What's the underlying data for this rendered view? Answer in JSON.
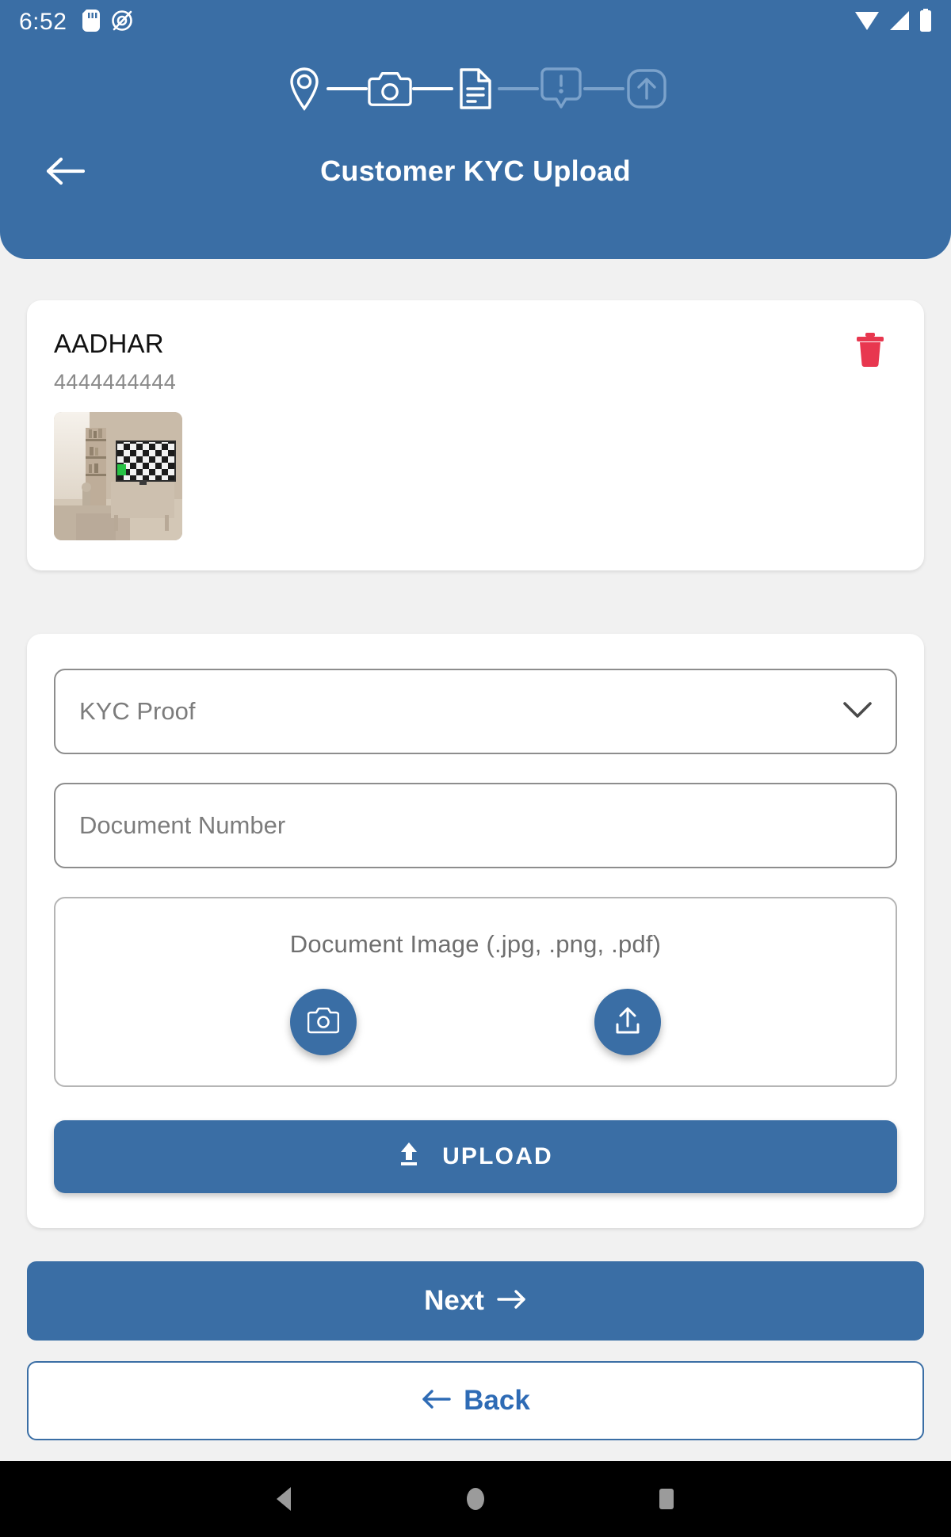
{
  "status_bar": {
    "time": "6:52",
    "left_icons": [
      "sd-card-icon",
      "vibrate-mode-icon"
    ],
    "right_icons": [
      "wifi-icon",
      "cellular-signal-icon",
      "battery-icon"
    ]
  },
  "header": {
    "title": "Customer KYC Upload",
    "back_icon": "arrow-left-icon",
    "background_color": "#3a6ea5",
    "stepper": {
      "steps": [
        {
          "icon": "location-pin-icon",
          "state": "completed"
        },
        {
          "icon": "camera-icon",
          "state": "completed"
        },
        {
          "icon": "document-icon",
          "state": "current"
        },
        {
          "icon": "alert-bubble-icon",
          "state": "pending"
        },
        {
          "icon": "upload-box-icon",
          "state": "pending"
        }
      ],
      "active_color": "#ffffff",
      "inactive_color": "#7ba2cb"
    }
  },
  "uploaded_documents": [
    {
      "title": "AADHAR",
      "number": "4444444444",
      "thumbnail_alt": "room-interior-photo",
      "delete_icon": "trash-icon",
      "delete_color": "#e8374f"
    }
  ],
  "form": {
    "kyc_proof_select": {
      "value": "KYC Proof",
      "chevron_icon": "chevron-down-icon"
    },
    "document_number_input": {
      "value": "",
      "placeholder": "Document Number"
    },
    "document_image": {
      "label": "Document Image (.jpg, .png, .pdf)",
      "camera_button_icon": "camera-icon",
      "upload_button_icon": "upload-icon"
    },
    "upload_button": {
      "label": "UPLOAD",
      "icon": "upload-arrow-icon"
    }
  },
  "navigation": {
    "next": {
      "label": "Next",
      "icon": "arrow-right-icon"
    },
    "back": {
      "label": "Back",
      "icon": "arrow-left-icon"
    }
  },
  "system_nav": {
    "back_icon": "triangle-back-icon",
    "home_icon": "circle-home-icon",
    "recents_icon": "square-recents-icon"
  },
  "theme": {
    "primary": "#3a6ea5",
    "page_background": "#f1f1f1",
    "card_background": "#ffffff",
    "muted_text": "#8a8a8a",
    "danger": "#e8374f",
    "link_blue": "#2e6bb5"
  }
}
